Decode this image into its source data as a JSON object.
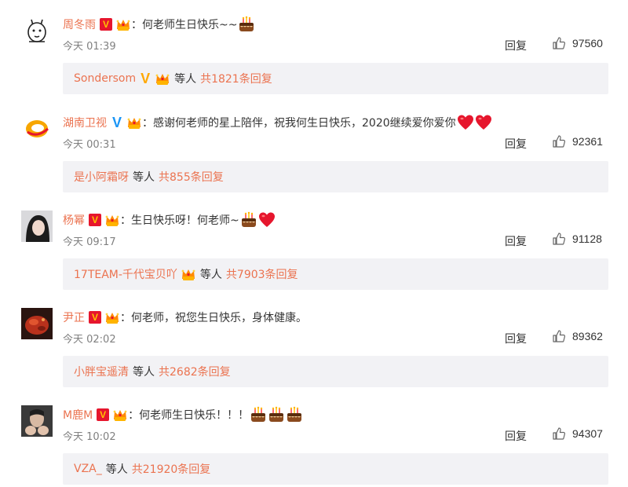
{
  "comments": [
    {
      "username": "周冬雨",
      "badge": "red-v",
      "text": "：何老师生日快乐~~",
      "emojis": [
        "cake"
      ],
      "time": "今天 01:39",
      "reply_label": "回复",
      "likes": "97560",
      "sub_user": "Sondersom",
      "sub_badge": "orange-v",
      "sub_etc": "等人",
      "sub_count": "共1821条回复",
      "avatar": "cartoon-sketch"
    },
    {
      "username": "湖南卫视",
      "badge": "blue-v",
      "text": "：感谢何老师的星上陪伴，祝我何生日快乐，2020继续爱你爱你",
      "emojis": [
        "heart",
        "heart"
      ],
      "time": "今天 00:31",
      "reply_label": "回复",
      "likes": "92361",
      "sub_user": "是小阿霜呀",
      "sub_badge": "",
      "sub_etc": "等人",
      "sub_count": "共855条回复",
      "avatar": "hunan-tv-logo"
    },
    {
      "username": "杨幂",
      "badge": "red-v",
      "text": "：生日快乐呀！何老师~",
      "emojis": [
        "cake",
        "heart"
      ],
      "time": "今天 09:17",
      "reply_label": "回复",
      "likes": "91128",
      "sub_user": "17TEAM-千代宝贝吖",
      "sub_badge": "crown",
      "sub_etc": "等人",
      "sub_count": "共7903条回复",
      "avatar": "portrait-dark-hair"
    },
    {
      "username": "尹正",
      "badge": "red-v",
      "text": "：何老师，祝您生日快乐，身体健康。",
      "emojis": [],
      "time": "今天 02:02",
      "reply_label": "回复",
      "likes": "89362",
      "sub_user": "小胖宝遥清",
      "sub_badge": "",
      "sub_etc": "等人",
      "sub_count": "共2682条回复",
      "avatar": "portrait-red-food"
    },
    {
      "username": "M鹿M",
      "badge": "red-v",
      "text": "：何老师生日快乐！！！",
      "emojis": [
        "cake",
        "cake",
        "cake"
      ],
      "time": "今天 10:02",
      "reply_label": "回复",
      "likes": "94307",
      "sub_user": "VZA_",
      "sub_badge": "",
      "sub_etc": "等人",
      "sub_count": "共21920条回复",
      "avatar": "portrait-hands"
    }
  ],
  "colors": {
    "username": "#eb7350",
    "text": "#333333",
    "meta": "#808080",
    "subbox_bg": "#f2f2f5",
    "v_red": "#e6162d",
    "v_gold": "#ffc200",
    "v_blue": "#1b95f5",
    "v_orange": "#ffa800"
  }
}
